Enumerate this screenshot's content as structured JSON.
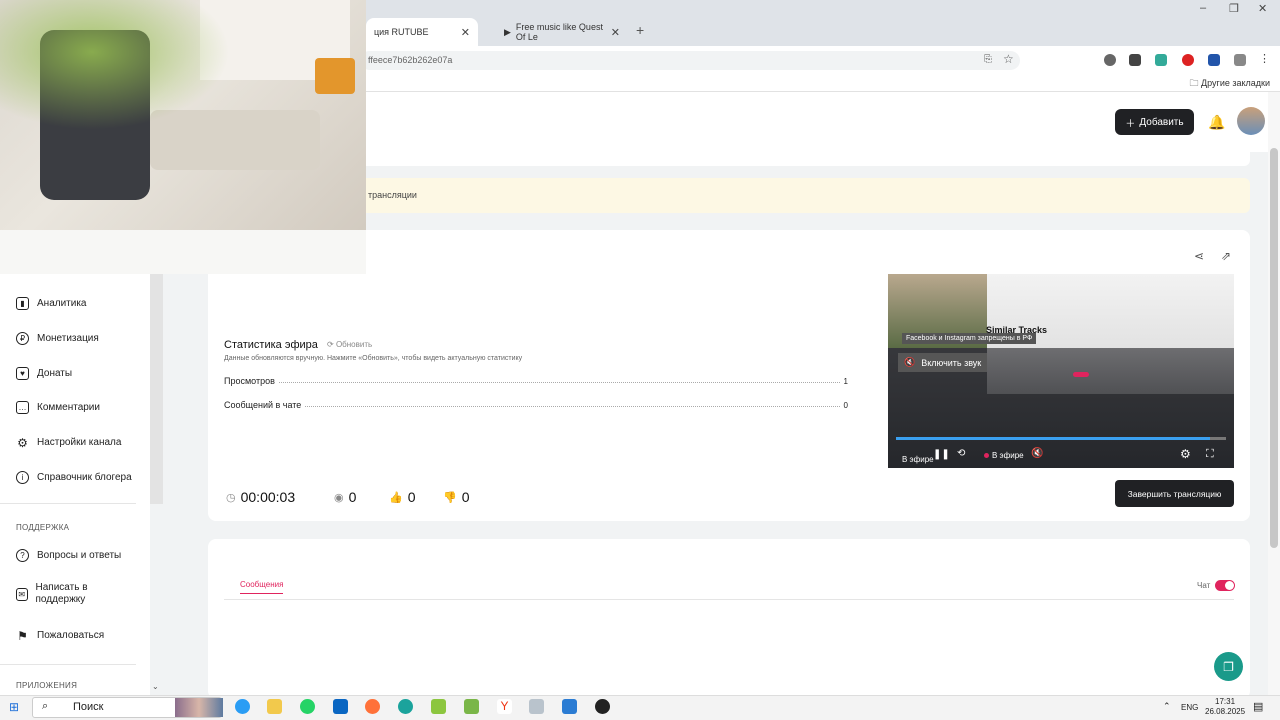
{
  "browser": {
    "tabs": [
      {
        "label": "ция RUTUBE",
        "active": true
      },
      {
        "label": "Free music like Quest Of Le",
        "active": false
      }
    ],
    "url": "ffeece7b62b262e07a",
    "bookmarks_label": "Другие закладки"
  },
  "header": {
    "add_button": "Добавить"
  },
  "banner": {
    "text": "трансляции"
  },
  "sidebar": {
    "items": [
      {
        "label": "Аналитика",
        "icon": "chart-icon"
      },
      {
        "label": "Монетизация",
        "icon": "coin-icon"
      },
      {
        "label": "Донаты",
        "icon": "donate-icon"
      },
      {
        "label": "Комментарии",
        "icon": "comment-icon"
      },
      {
        "label": "Настройки канала",
        "icon": "gear-icon"
      },
      {
        "label": "Справочник блогера",
        "icon": "book-icon"
      }
    ],
    "support_title": "ПОДДЕРЖКА",
    "support_items": [
      {
        "label": "Вопросы и ответы",
        "icon": "question-icon"
      },
      {
        "label": "Написать в поддержку",
        "icon": "mail-icon"
      },
      {
        "label": "Пожаловаться",
        "icon": "flag-icon"
      }
    ],
    "apps_title": "ПРИЛОЖЕНИЯ"
  },
  "stats": {
    "title": "Статистика эфира",
    "refresh": "Обновить",
    "note": "Данные обновляются вручную. Нажмите «Обновить», чтобы видеть актуальную статистику",
    "rows": [
      {
        "label": "Просмотров",
        "value": "1"
      },
      {
        "label": "Сообщений в чате",
        "value": "0"
      }
    ]
  },
  "metrics": {
    "duration": "00:00:03",
    "viewers": "0",
    "likes": "0",
    "dislikes": "0"
  },
  "player": {
    "notice": "Facebook и Instagram запрещены в РФ",
    "unmute": "Включить звук",
    "overlay_title": "Similar Tracks",
    "live_label": "В эфире",
    "live_label2": "В эфире",
    "progress": 0.95
  },
  "actions": {
    "end_stream": "Завершить трансляцию"
  },
  "chat": {
    "messages_tab": "Сообщения",
    "chat_label": "Чат",
    "chat_enabled": true
  },
  "taskbar": {
    "search": "Поиск",
    "lang": "ENG",
    "time": "17:31",
    "date": "26.08.2025"
  },
  "colors": {
    "accent": "#e0245e",
    "dark_button": "#202124",
    "banner": "#fdf8e4"
  }
}
